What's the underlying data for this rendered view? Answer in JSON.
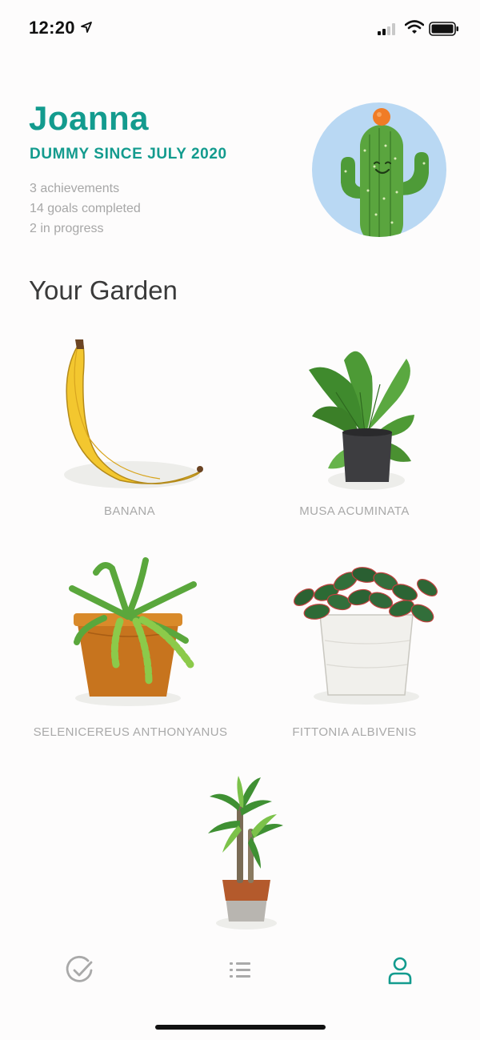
{
  "status_bar": {
    "time": "12:20"
  },
  "profile": {
    "name": "Joanna",
    "since": "DUMMY SINCE JULY 2020",
    "stats": [
      "3 achievements",
      "14 goals completed",
      "2 in progress"
    ]
  },
  "garden": {
    "title": "Your Garden",
    "plants": [
      {
        "label": "BANANA"
      },
      {
        "label": "MUSA ACUMINATA"
      },
      {
        "label": "SELENICEREUS ANTHONYANUS"
      },
      {
        "label": "FITTONIA ALBIVENIS"
      },
      {
        "label": ""
      }
    ]
  },
  "tab_bar": {
    "tabs": [
      {
        "icon": "check-circle-icon",
        "active": false
      },
      {
        "icon": "list-icon",
        "active": false
      },
      {
        "icon": "person-icon",
        "active": true
      }
    ]
  },
  "colors": {
    "accent": "#139b8e",
    "muted": "#a9a9a9"
  }
}
